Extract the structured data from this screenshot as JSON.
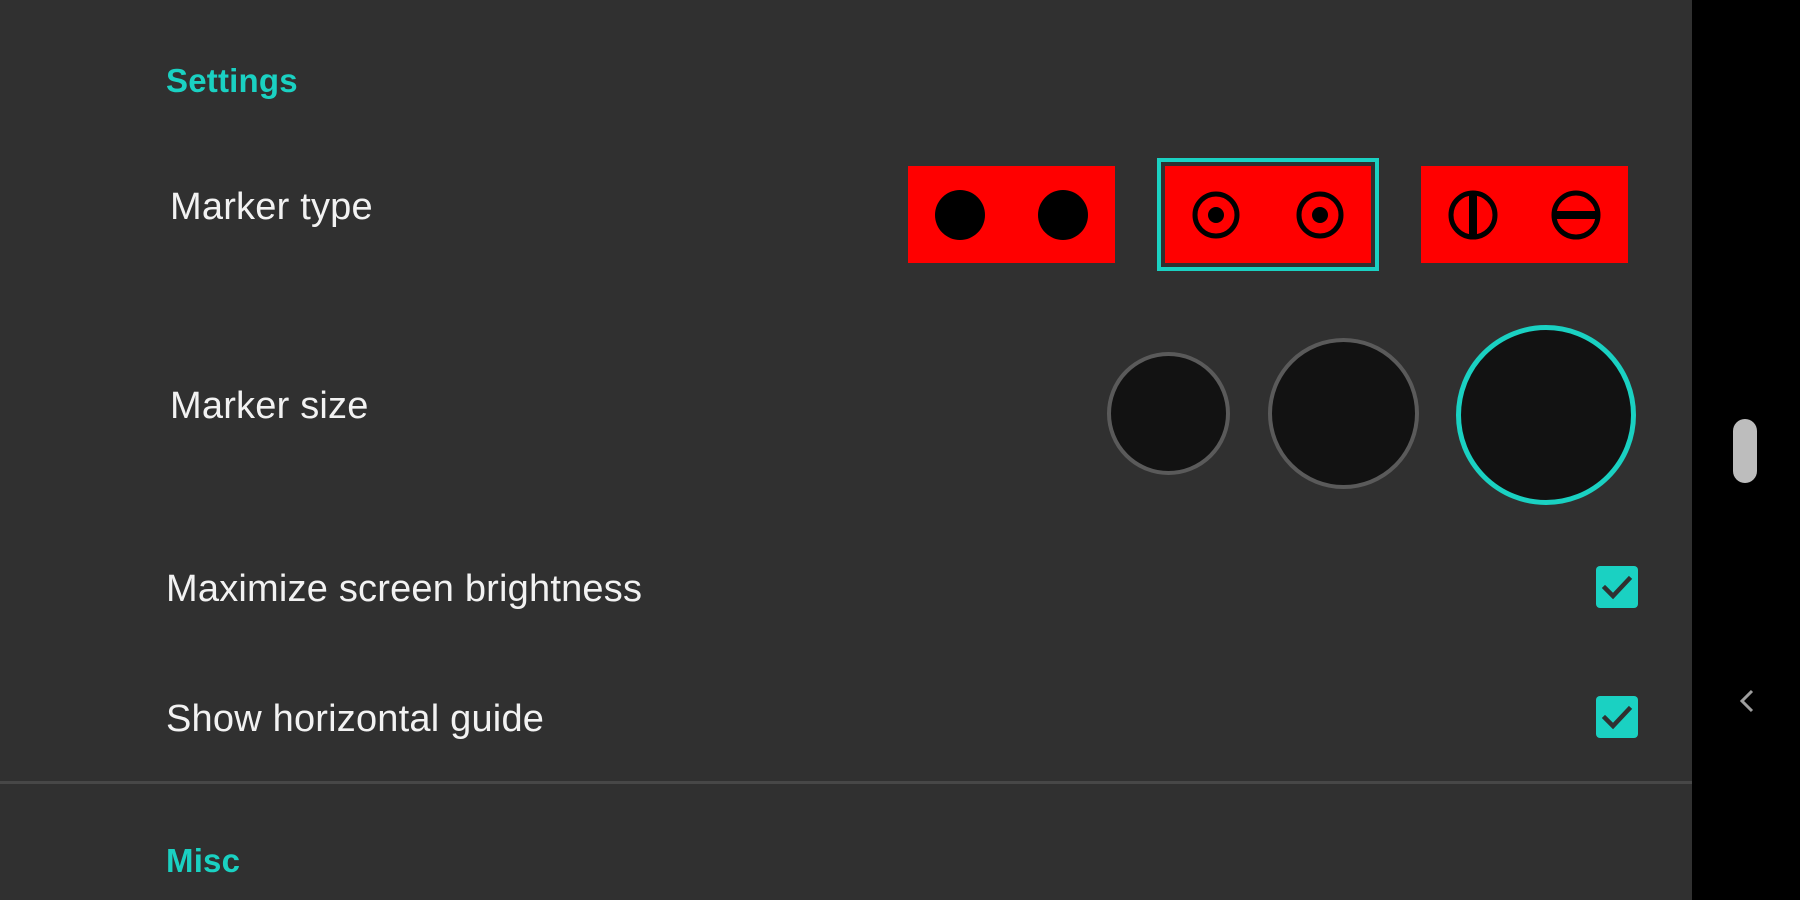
{
  "colors": {
    "background": "#303030",
    "accent": "#1ad1c2",
    "marker_red": "#ff0000",
    "text": "#f2f2f2",
    "size_fill": "#121212",
    "size_border": "#5a5a5a",
    "nav_background": "#000000"
  },
  "settings": {
    "header": "Settings",
    "marker_type": {
      "label": "Marker type",
      "options": [
        {
          "icon": "filled-dot-pair-icon",
          "selected": false
        },
        {
          "icon": "ring-dot-pair-icon",
          "selected": true
        },
        {
          "icon": "split-circle-pair-icon",
          "selected": false
        }
      ]
    },
    "marker_size": {
      "label": "Marker size",
      "options": [
        {
          "size": "small",
          "selected": false
        },
        {
          "size": "medium",
          "selected": false
        },
        {
          "size": "large",
          "selected": true
        }
      ]
    },
    "maximize_brightness": {
      "label": "Maximize screen brightness",
      "checked": true
    },
    "horizontal_guide": {
      "label": "Show horizontal guide",
      "checked": true
    }
  },
  "misc": {
    "header": "Misc"
  },
  "navbar": {
    "back_icon": "chevron-left-icon",
    "scroll_icon": "scroll-handle"
  }
}
